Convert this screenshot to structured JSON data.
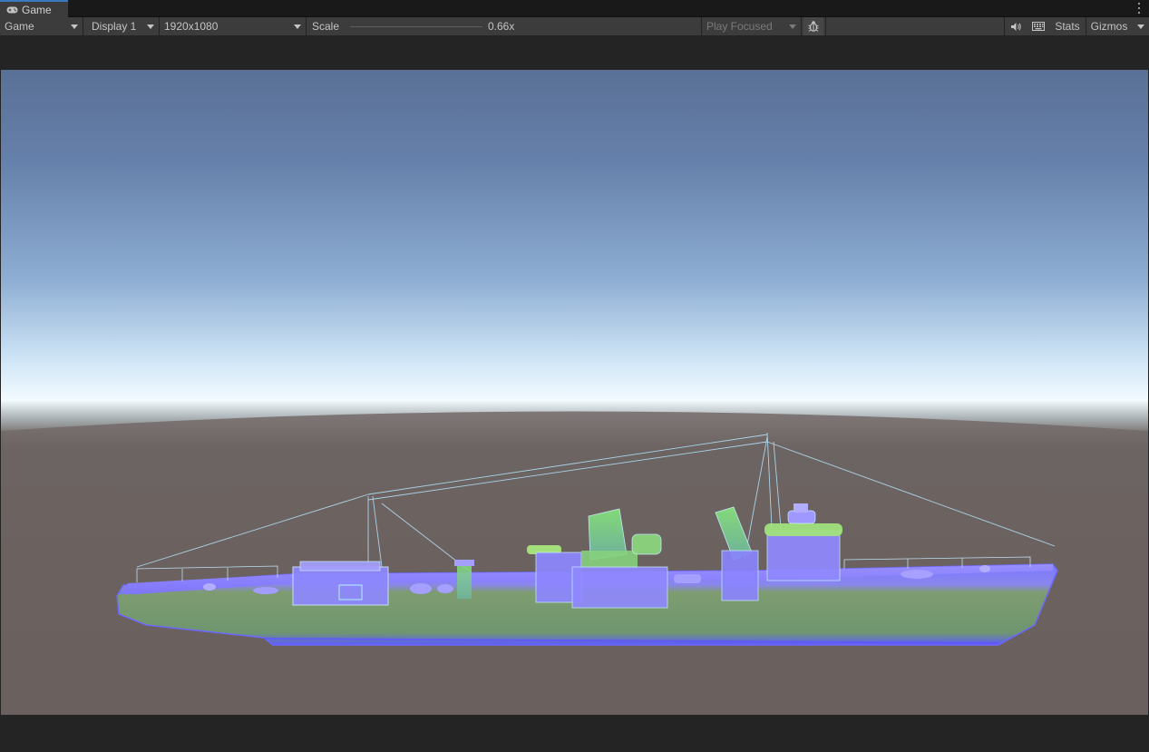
{
  "tab": {
    "title": "Game",
    "icon": "gamepad-icon"
  },
  "toolbar": {
    "view_mode": "Game",
    "display": "Display 1",
    "resolution": "1920x1080",
    "scale_label": "Scale",
    "scale_value": "0.66x",
    "play_mode": "Play Focused",
    "stats_label": "Stats",
    "gizmos_label": "Gizmos",
    "icons": [
      "bug-icon",
      "speaker-icon",
      "keyboard-icon",
      "dropdown-arrow-icon"
    ]
  },
  "scene": {
    "sky_top_color": "#5b7299",
    "horizon_color": "#f3fbff",
    "ground_color": "#6b6260",
    "ship_colors": {
      "hull": "#7a9a6a",
      "hull_edge": "#7f70ff",
      "deck": "#8f82ff",
      "wire": "#b8e6ff",
      "superstructure": "#86d27c"
    }
  }
}
